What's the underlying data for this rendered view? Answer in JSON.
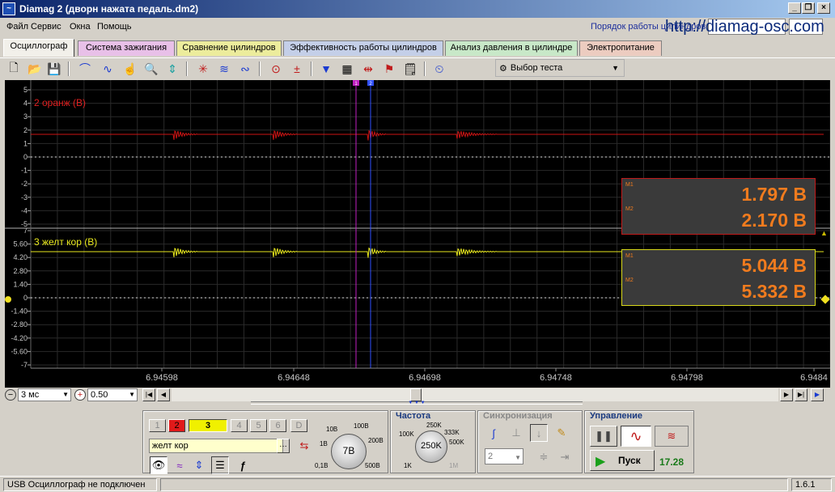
{
  "window": {
    "title": "Diamag 2 (дворн нажата педаль.dm2)"
  },
  "menu": {
    "items": [
      "Файл",
      "Сервис",
      "Окна",
      "Помощь"
    ],
    "cyl_order_label": "Порядок работы цилиндров",
    "site": "http://diamag-osc.com"
  },
  "tabs": [
    {
      "label": "Осциллограф",
      "color": "#f2f0ea"
    },
    {
      "label": "Система зажигания",
      "color": "#e8c0e8"
    },
    {
      "label": "Сравнение цилиндров",
      "color": "#ecec9c"
    },
    {
      "label": "Эффективность работы цилиндров",
      "color": "#c4cfe8"
    },
    {
      "label": "Анализ давления в цилиндре",
      "color": "#c8e8c8"
    },
    {
      "label": "Электропитание",
      "color": "#ecccc0"
    }
  ],
  "toolbar": {
    "test_select_label": "Выбор теста"
  },
  "scope": {
    "channel1": {
      "label": "2 оранж (В)",
      "color": "#cc1414",
      "y_ticks": [
        "5",
        "4",
        "3",
        "2",
        "1",
        "0",
        "-1",
        "-2",
        "-3",
        "-4",
        "-5"
      ],
      "m1": "M1",
      "m2": "M2",
      "value1": "1.797 В",
      "value2": "2.170 В"
    },
    "channel2": {
      "label": "3 желт кор (В)",
      "color": "#e8e81e",
      "y_ticks": [
        "7",
        "5.60",
        "4.20",
        "2.80",
        "1.40",
        "0",
        "-1.40",
        "-2.80",
        "-4.20",
        "-5.60",
        "-7"
      ],
      "m1": "M1",
      "m2": "M2",
      "value1": "5.044 В",
      "value2": "5.332 В"
    },
    "x_ticks": [
      "6.94598",
      "6.94648",
      "6.94698",
      "6.94748",
      "6.94798",
      "6.9484"
    ],
    "marker1": "1",
    "marker2": "2"
  },
  "scroll": {
    "time_scale": "3 мс",
    "zoom": "0.50"
  },
  "channels": {
    "buttons": [
      "1",
      "2",
      "3",
      "4",
      "5",
      "6",
      "D"
    ],
    "channel_name": "желт кор"
  },
  "voltage": {
    "ticks": [
      "10В",
      "100В",
      "1В",
      "200В",
      "0,1В",
      "500В"
    ],
    "value": "7В"
  },
  "frequency": {
    "title": "Частота",
    "ticks": [
      "250K",
      "100K",
      "333K",
      "500K",
      "1K",
      "1M"
    ],
    "value": "250K"
  },
  "sync": {
    "title": "Синхронизация",
    "channel": "2"
  },
  "control": {
    "title": "Управление",
    "start_label": "Пуск",
    "fps": "17.28"
  },
  "status": {
    "message": "USB Осциллограф не подключен",
    "version": "1.6.1"
  }
}
